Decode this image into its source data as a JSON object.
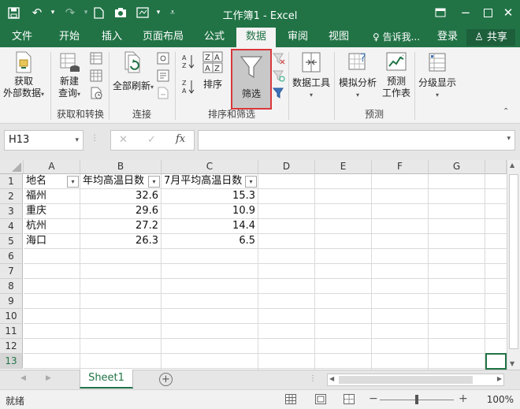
{
  "titlebar": {
    "title": "工作簿1 - Excel",
    "save_icon": "save-icon",
    "undo_icon": "undo-icon",
    "redo_icon": "redo-icon"
  },
  "tabs": [
    {
      "label": "文件",
      "active": false
    },
    {
      "label": "开始",
      "active": false
    },
    {
      "label": "插入",
      "active": false
    },
    {
      "label": "页面布局",
      "active": false
    },
    {
      "label": "公式",
      "active": false
    },
    {
      "label": "数据",
      "active": true
    },
    {
      "label": "审阅",
      "active": false
    },
    {
      "label": "视图",
      "active": false
    }
  ],
  "tell_me": "告诉我...",
  "login": "登录",
  "share": "共享",
  "ribbon": {
    "get_external": {
      "line1": "获取",
      "line2": "外部数据"
    },
    "new_query": {
      "line1": "新建",
      "line2": "查询"
    },
    "group_get_transform": "获取和转换",
    "refresh_all": "全部刷新",
    "group_connections": "连接",
    "sort": "排序",
    "filter": "筛选",
    "group_sort_filter": "排序和筛选",
    "data_tools": "数据工具",
    "what_if": "模拟分析",
    "forecast": {
      "line1": "预测",
      "line2": "工作表"
    },
    "group_forecast": "预测",
    "outline": "分级显示"
  },
  "formula_bar": {
    "name_box": "H13",
    "fx": "fx",
    "value": ""
  },
  "columns": [
    "A",
    "B",
    "C",
    "D",
    "E",
    "F",
    "G"
  ],
  "rows": [
    "1",
    "2",
    "3",
    "4",
    "5",
    "6",
    "7",
    "8",
    "9",
    "10",
    "11",
    "12",
    "13"
  ],
  "table": {
    "headers": [
      "地名",
      "年均高温日数",
      "7月平均高温日数"
    ],
    "rows": [
      {
        "name": "福州",
        "annual": "32.6",
        "july": "15.3"
      },
      {
        "name": "重庆",
        "annual": "29.6",
        "july": "10.9"
      },
      {
        "name": "杭州",
        "annual": "27.2",
        "july": "14.4"
      },
      {
        "name": "海口",
        "annual": "26.3",
        "july": "6.5"
      }
    ]
  },
  "sheet_tab": "Sheet1",
  "status": {
    "ready": "就绪",
    "zoom": "100%"
  },
  "colors": {
    "brand": "#217346",
    "highlight_border": "#d9383a"
  }
}
